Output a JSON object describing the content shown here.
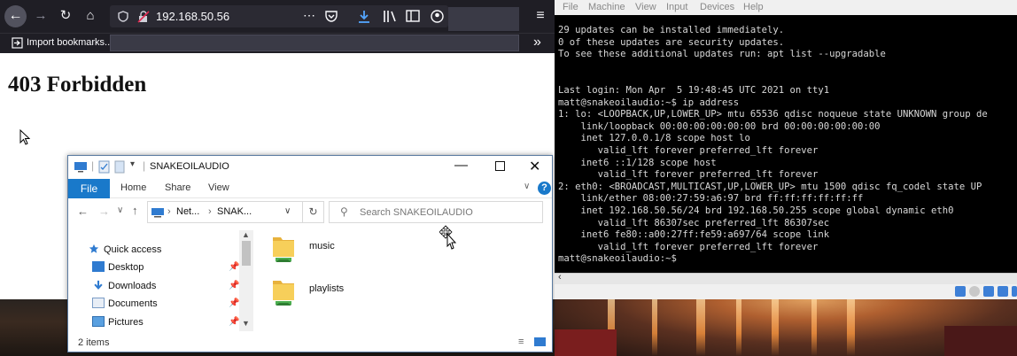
{
  "colors": {
    "firefox_toolbar": "#1f1e25",
    "explorer_accent": "#1979ca",
    "terminal_bg": "#000000",
    "terminal_fg": "#d8d8d8"
  },
  "firefox": {
    "url": "192.168.50.56",
    "bookmark_label": "Import bookmarks...",
    "page_heading": "403 Forbidden",
    "overflow_label": "»",
    "menu_label": "≡"
  },
  "explorer": {
    "title": "SNAKEOILAUDIO",
    "ribbon": {
      "file": "File",
      "tabs": [
        "Home",
        "Share",
        "View"
      ]
    },
    "address": {
      "seg1": "Net...",
      "seg2": "SNAK..."
    },
    "search_placeholder": "Search SNAKEOILAUDIO",
    "nav": [
      "Quick access",
      "Desktop",
      "Downloads",
      "Documents",
      "Pictures"
    ],
    "items": [
      "music",
      "playlists"
    ],
    "status": "2 items"
  },
  "vm": {
    "menu": [
      "File",
      "Machine",
      "View",
      "Input",
      "Devices",
      "Help"
    ],
    "terminal_lines": [
      "29 updates can be installed immediately.",
      "0 of these updates are security updates.",
      "To see these additional updates run: apt list --upgradable",
      "",
      "",
      "Last login: Mon Apr  5 19:48:45 UTC 2021 on tty1",
      "matt@snakeoilaudio:~$ ip address",
      "1: lo: <LOOPBACK,UP,LOWER_UP> mtu 65536 qdisc noqueue state UNKNOWN group de",
      "    link/loopback 00:00:00:00:00:00 brd 00:00:00:00:00:00",
      "    inet 127.0.0.1/8 scope host lo",
      "       valid_lft forever preferred_lft forever",
      "    inet6 ::1/128 scope host",
      "       valid_lft forever preferred_lft forever",
      "2: eth0: <BROADCAST,MULTICAST,UP,LOWER_UP> mtu 1500 qdisc fq_codel state UP",
      "    link/ether 08:00:27:59:a6:97 brd ff:ff:ff:ff:ff:ff",
      "    inet 192.168.50.56/24 brd 192.168.50.255 scope global dynamic eth0",
      "       valid_lft 86307sec preferred_lft 86307sec",
      "    inet6 fe80::a00:27ff:fe59:a697/64 scope link",
      "       valid_lft forever preferred_lft forever",
      "matt@snakeoilaudio:~$"
    ]
  }
}
